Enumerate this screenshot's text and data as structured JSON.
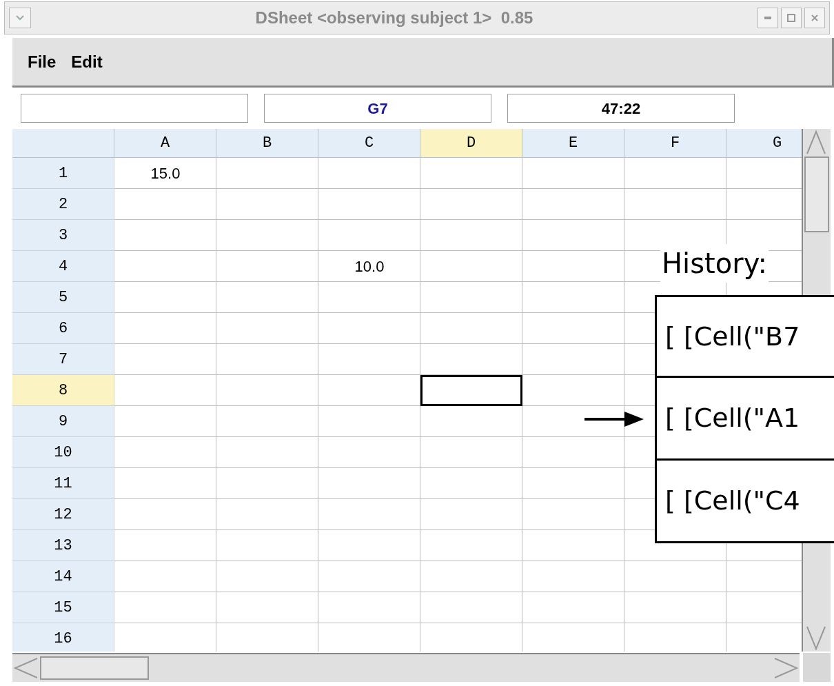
{
  "window": {
    "title": "DSheet <observing subject 1>  0.85"
  },
  "menu": [
    {
      "label": "File"
    },
    {
      "label": "Edit"
    }
  ],
  "fields": [
    {
      "kind": "plain"
    },
    {
      "value": "G7",
      "kind": "cell-ref"
    },
    {
      "value": "47:22",
      "kind": "plain"
    }
  ],
  "columns": [
    {
      "label": "A",
      "selected": false
    },
    {
      "label": "B",
      "selected": false
    },
    {
      "label": "C",
      "selected": false
    },
    {
      "label": "D",
      "selected": true
    },
    {
      "label": "E",
      "selected": false
    },
    {
      "label": "F",
      "selected": false
    },
    {
      "label": "G",
      "selected": false
    }
  ],
  "rows": [
    {
      "label": "1",
      "selected": false,
      "cells": [
        "15.0"
      ]
    },
    {
      "label": "2",
      "selected": false
    },
    {
      "label": "3",
      "selected": false
    },
    {
      "label": "4",
      "selected": false,
      "cells": [
        null,
        null,
        "10.0"
      ]
    },
    {
      "label": "5",
      "selected": false
    },
    {
      "label": "6",
      "selected": false
    },
    {
      "label": "7",
      "selected": false
    },
    {
      "label": "8",
      "selected": true
    },
    {
      "label": "9",
      "selected": false
    },
    {
      "label": "10",
      "selected": false
    },
    {
      "label": "11",
      "selected": false
    },
    {
      "label": "12",
      "selected": false
    },
    {
      "label": "13",
      "selected": false
    },
    {
      "label": "14",
      "selected": false
    },
    {
      "label": "15",
      "selected": false
    },
    {
      "label": "16",
      "selected": false
    }
  ],
  "history": {
    "title": "History:",
    "entries": [
      {
        "text": "[ [Cell(\"B7",
        "current": false
      },
      {
        "text": "[ [Cell(\"A1",
        "current": true
      },
      {
        "text": "[ [Cell(\"C4",
        "current": false
      }
    ]
  }
}
